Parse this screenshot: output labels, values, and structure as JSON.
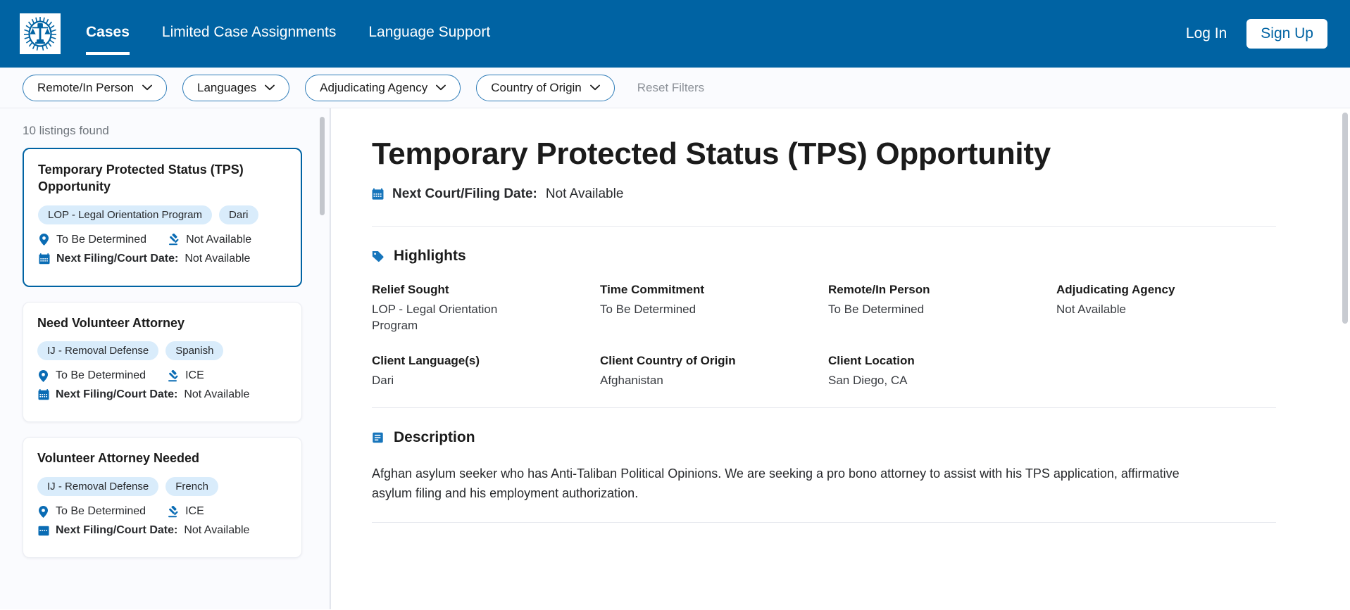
{
  "brand": {
    "logo_icon": "justice-scales-seal-icon",
    "primary_color": "#0063A3",
    "tag_bg_color": "#d9ecfb"
  },
  "header": {
    "nav": [
      {
        "label": "Cases",
        "active": true
      },
      {
        "label": "Limited Case Assignments",
        "active": false
      },
      {
        "label": "Language Support",
        "active": false
      }
    ],
    "login_label": "Log In",
    "signup_label": "Sign Up"
  },
  "filters": {
    "pills": [
      {
        "label": "Remote/In Person"
      },
      {
        "label": "Languages"
      },
      {
        "label": "Adjudicating Agency"
      },
      {
        "label": "Country of Origin"
      }
    ],
    "reset_label": "Reset Filters"
  },
  "sidebar": {
    "count_text": "10 listings found",
    "listings": [
      {
        "title": "Temporary Protected Status (TPS) Opportunity",
        "tags": [
          "LOP - Legal Orientation Program",
          "Dari"
        ],
        "location": "To Be Determined",
        "agency": "Not Available",
        "date_label": "Next Filing/Court Date:",
        "date_value": "Not Available",
        "selected": true
      },
      {
        "title": "Need Volunteer Attorney",
        "tags": [
          "IJ - Removal Defense",
          "Spanish"
        ],
        "location": "To Be Determined",
        "agency": "ICE",
        "date_label": "Next Filing/Court Date:",
        "date_value": "Not Available",
        "selected": false
      },
      {
        "title": "Volunteer Attorney Needed",
        "tags": [
          "IJ - Removal Defense",
          "French"
        ],
        "location": "To Be Determined",
        "agency": "ICE",
        "date_label": "Next Filing/Court Date:",
        "date_value": "Not Available",
        "selected": false
      }
    ]
  },
  "detail": {
    "title": "Temporary Protected Status (TPS) Opportunity",
    "next_date_label": "Next Court/Filing Date:",
    "next_date_value": "Not Available",
    "highlights": {
      "heading": "Highlights",
      "icon": "tag-icon",
      "items": [
        {
          "label": "Relief Sought",
          "value": "LOP - Legal Orientation Program"
        },
        {
          "label": "Time Commitment",
          "value": "To Be Determined"
        },
        {
          "label": "Remote/In Person",
          "value": "To Be Determined"
        },
        {
          "label": "Adjudicating Agency",
          "value": "Not Available"
        },
        {
          "label": "Client Language(s)",
          "value": "Dari"
        },
        {
          "label": "Client Country of Origin",
          "value": "Afghanistan"
        },
        {
          "label": "Client Location",
          "value": "San Diego, CA"
        }
      ]
    },
    "description": {
      "heading": "Description",
      "icon": "document-lines-icon",
      "text": "Afghan asylum seeker who has Anti-Taliban Political Opinions. We are seeking a pro bono attorney to assist with his TPS application, affirmative asylum filing and his employment authorization."
    }
  }
}
